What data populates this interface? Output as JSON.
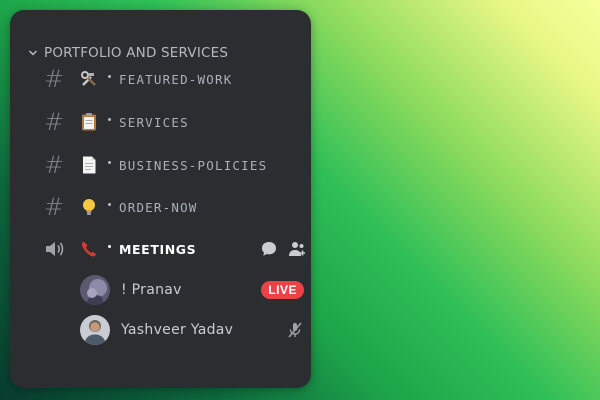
{
  "category": {
    "title": "PORTFOLIO AND SERVICES",
    "icon": "chevron-down-icon"
  },
  "channels": [
    {
      "name": "FEATURED-WORK",
      "type": "text",
      "emoji": "hammer-and-wrench-icon"
    },
    {
      "name": "SERVICES",
      "type": "text",
      "emoji": "clipboard-icon"
    },
    {
      "name": "BUSINESS-POLICIES",
      "type": "text",
      "emoji": "page-facing-up-icon"
    },
    {
      "name": "ORDER-NOW",
      "type": "text",
      "emoji": "light-bulb-icon"
    },
    {
      "name": "MEETINGS",
      "type": "voice",
      "emoji": "telephone-receiver-icon",
      "active": true
    }
  ],
  "voice_users": [
    {
      "name": "! Pranav",
      "badge": "LIVE"
    },
    {
      "name": "Yashveer Yadav",
      "status_icon": "mic-muted-icon"
    }
  ],
  "colors": {
    "panel": "#2b2d31",
    "live": "#ed4245",
    "muted_text": "#b5bac1"
  }
}
